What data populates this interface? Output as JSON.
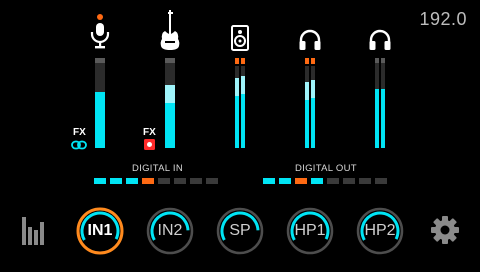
{
  "sample_rate": "192.0",
  "inputs_label": "DIGITAL IN",
  "outputs_label": "DIGITAL OUT",
  "fx_label": "FX",
  "channels": [
    {
      "id": "in1",
      "icon": "microphone-icon",
      "record_armed": true,
      "fx": "link-icon",
      "meter_level": 0.62
    },
    {
      "id": "in2",
      "icon": "guitar-icon",
      "record_armed": false,
      "fx": "record-button-icon",
      "meter_level": 0.7
    },
    {
      "id": "sp",
      "icon": "speaker-icon",
      "clip": [
        true,
        true
      ],
      "meter_levels": [
        0.85,
        0.88
      ]
    },
    {
      "id": "hp1",
      "icon": "headphones-icon",
      "clip": [
        true,
        true
      ],
      "meter_levels": [
        0.8,
        0.83
      ]
    },
    {
      "id": "hp2",
      "icon": "headphones-icon",
      "clip": [
        false,
        false
      ],
      "meter_levels": [
        0.66,
        0.66
      ]
    }
  ],
  "digital_in_leds": [
    "on",
    "on",
    "on",
    "hot",
    "off",
    "off",
    "off",
    "off"
  ],
  "digital_out_leds": [
    "on",
    "on",
    "hot",
    "on",
    "off",
    "off",
    "off",
    "off"
  ],
  "knobs": [
    {
      "label": "IN1",
      "selected": true,
      "value": 0.82
    },
    {
      "label": "IN2",
      "selected": false,
      "value": 0.72
    },
    {
      "label": "SP",
      "selected": false,
      "value": 0.72
    },
    {
      "label": "HP1",
      "selected": false,
      "value": 0.82
    },
    {
      "label": "HP2",
      "selected": false,
      "value": 0.82
    }
  ],
  "colors": {
    "accent": "#00e5f5",
    "hot": "#ff6a13",
    "selected_ring": "#ff8a1e",
    "track": "#3a3a3a",
    "idle_ring": "#4d4d4d"
  },
  "toolbar": {
    "levels_icon": "level-bars-icon",
    "settings_icon": "gear-icon"
  }
}
